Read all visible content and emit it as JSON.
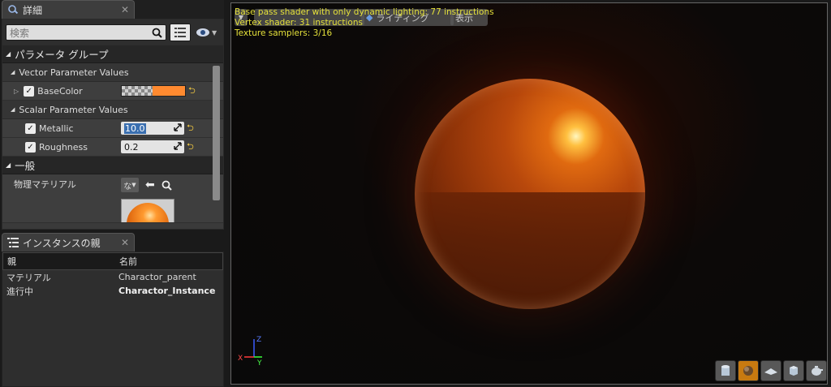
{
  "details": {
    "tab_title": "詳細",
    "search_placeholder": "検索",
    "category_params": "パラメータ グループ",
    "vector_header": "Vector Parameter Values",
    "base_color_label": "BaseColor",
    "base_color_hex": "#ff8a30",
    "scalar_header": "Scalar Parameter Values",
    "metallic_label": "Metallic",
    "metallic_value": "10.0",
    "roughness_label": "Roughness",
    "roughness_value": "0.2",
    "category_general": "一般",
    "phys_material_label": "物理マテリアル",
    "phys_material_dropdown": "な",
    "reset_glyph": "⮌"
  },
  "parents": {
    "tab_title": "インスタンスの親",
    "columns": [
      "親",
      "名前"
    ],
    "rows": [
      {
        "parent": "マテリアル",
        "name": "Charactor_parent"
      },
      {
        "parent": "進行中",
        "name": "Charactor_Instance"
      }
    ]
  },
  "viewport": {
    "stats": [
      "Base pass shader with only dynamic lighting: 77 instructions",
      "Vertex shader: 31 instructions",
      "Texture samplers: 3/16"
    ],
    "btn_lighting": "ライティング",
    "btn_show": "表示",
    "axis_x": "X",
    "axis_y": "Y",
    "axis_z": "Z"
  },
  "colors": {
    "accent": "#e4e03a",
    "highlight_tool": "#c87a10"
  }
}
